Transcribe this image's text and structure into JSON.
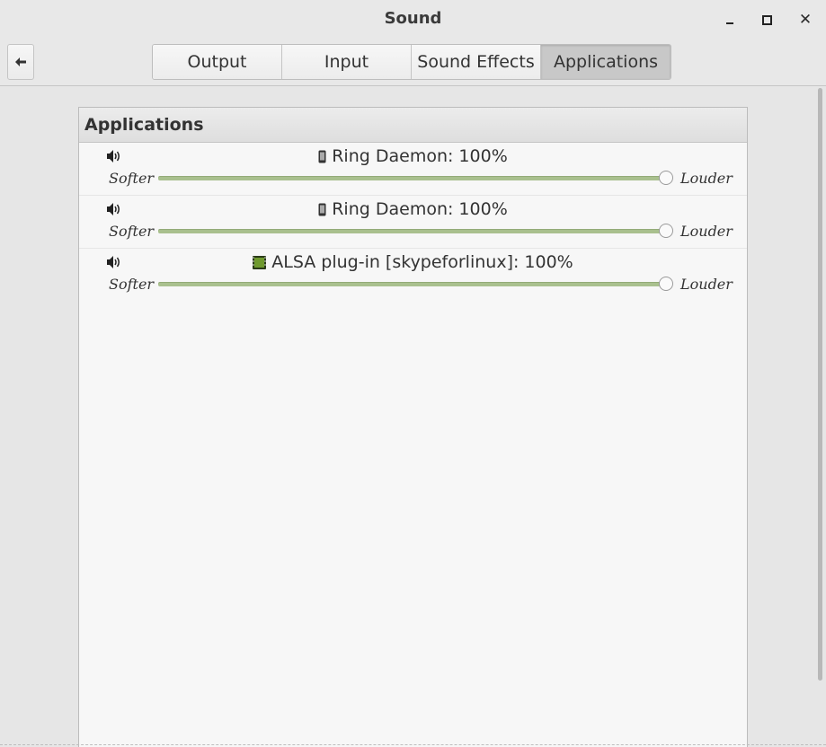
{
  "window": {
    "title": "Sound",
    "minimize_icon": "minimize-icon",
    "maximize_icon": "maximize-icon",
    "close_icon": "close-icon"
  },
  "toolbar": {
    "back_icon": "back-arrow-icon",
    "back_glyph": "🠔",
    "tabs": [
      {
        "label": "Output",
        "active": false
      },
      {
        "label": "Input",
        "active": false
      },
      {
        "label": "Sound Effects",
        "active": false
      },
      {
        "label": "Applications",
        "active": true
      }
    ]
  },
  "panel": {
    "title": "Applications",
    "apps": [
      {
        "name": "Ring Daemon: 100%",
        "icon": "phone-icon",
        "speaker_icon": "speaker-icon",
        "softer_label": "Softer",
        "louder_label": "Louder",
        "volume_percent": 100
      },
      {
        "name": "Ring Daemon: 100%",
        "icon": "phone-icon",
        "speaker_icon": "speaker-icon",
        "softer_label": "Softer",
        "louder_label": "Louder",
        "volume_percent": 100
      },
      {
        "name": "ALSA plug-in [skypeforlinux]: 100%",
        "icon": "media-icon",
        "speaker_icon": "speaker-icon",
        "softer_label": "Softer",
        "louder_label": "Louder",
        "volume_percent": 100
      }
    ]
  },
  "colors": {
    "slider_fill": "#a9c08e",
    "active_tab": "#c8c8c8",
    "window_bg": "#e8e8e8",
    "panel_bg": "#f7f7f7"
  }
}
